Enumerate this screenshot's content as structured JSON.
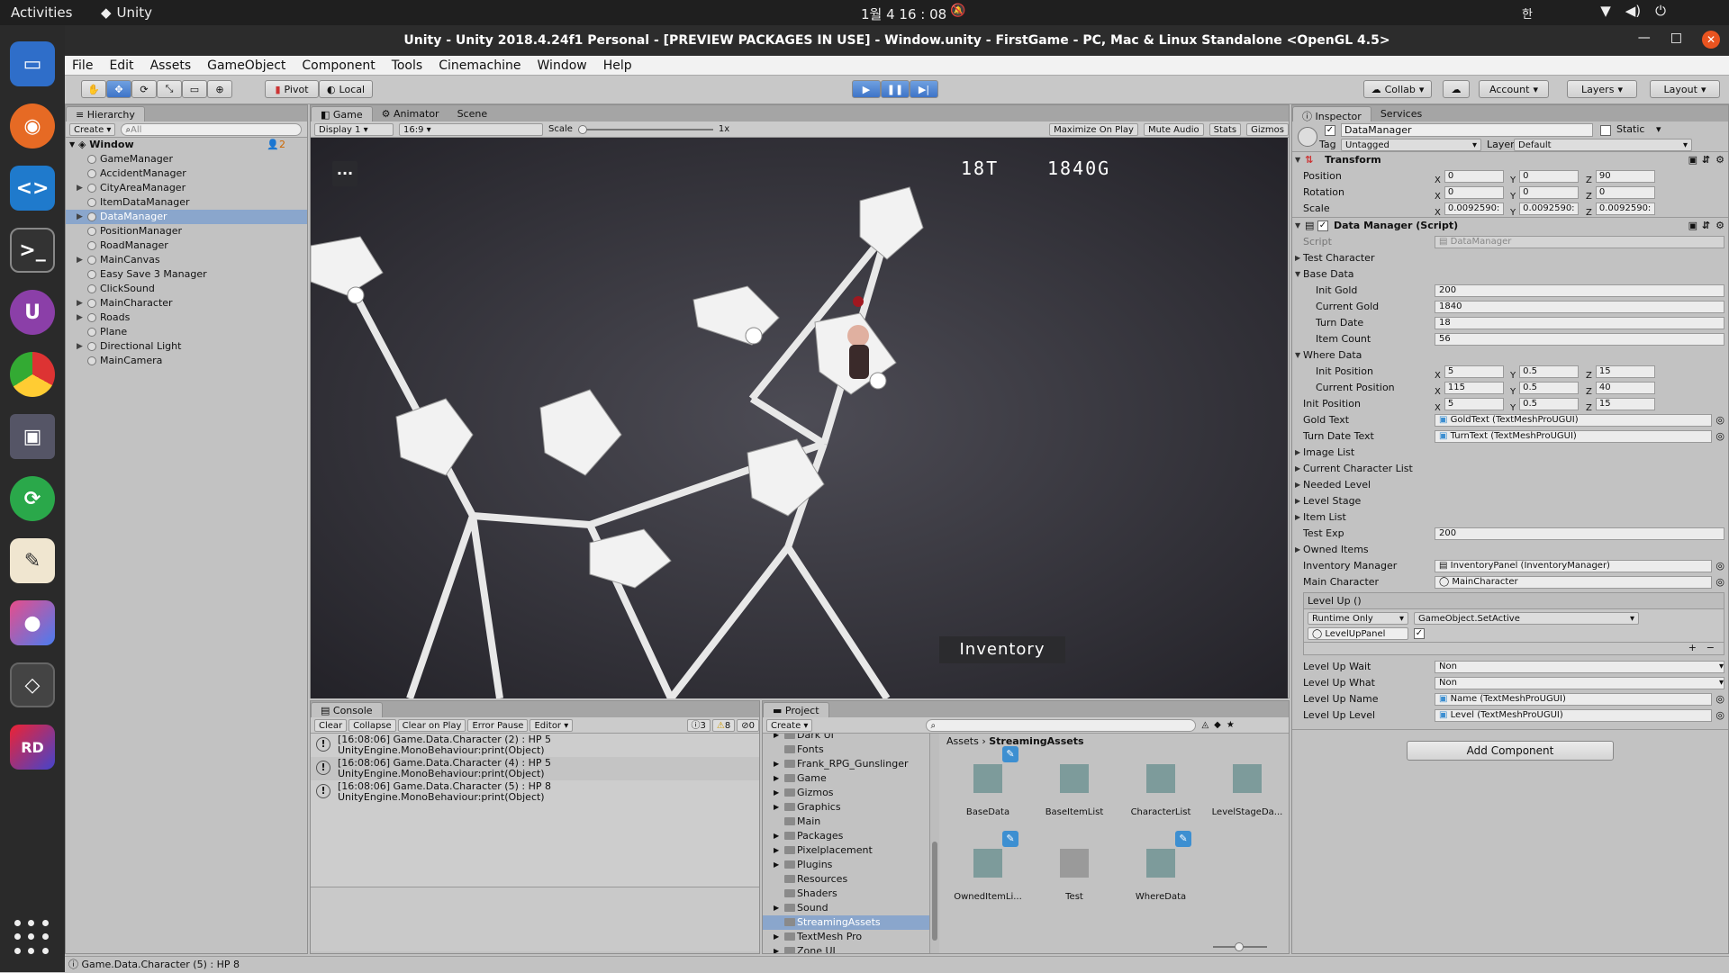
{
  "system_bar": {
    "activities": "Activities",
    "app_name": "Unity",
    "clock": "1월 4  16 : 08",
    "ime": "한"
  },
  "window": {
    "title": "Unity - Unity 2018.4.24f1 Personal - [PREVIEW PACKAGES IN USE] - Window.unity - FirstGame - PC, Mac & Linux Standalone <OpenGL 4.5>"
  },
  "menu": [
    "File",
    "Edit",
    "Assets",
    "GameObject",
    "Component",
    "Tools",
    "Cinemachine",
    "Window",
    "Help"
  ],
  "toolbar": {
    "pivot": "Pivot",
    "local": "Local",
    "collab": "Collab",
    "account": "Account",
    "layers": "Layers",
    "layout": "Layout"
  },
  "hierarchy": {
    "tab": "Hierarchy",
    "create": "Create",
    "search_placeholder": "All",
    "scene": "Window",
    "scene_count": "2",
    "items": [
      {
        "label": "GameManager",
        "expandable": false,
        "selected": false
      },
      {
        "label": "AccidentManager",
        "expandable": false,
        "selected": false
      },
      {
        "label": "CityAreaManager",
        "expandable": true,
        "selected": false
      },
      {
        "label": "ItemDataManager",
        "expandable": false,
        "selected": false
      },
      {
        "label": "DataManager",
        "expandable": true,
        "selected": true
      },
      {
        "label": "PositionManager",
        "expandable": false,
        "selected": false
      },
      {
        "label": "RoadManager",
        "expandable": false,
        "selected": false
      },
      {
        "label": "MainCanvas",
        "expandable": true,
        "selected": false
      },
      {
        "label": "Easy Save 3 Manager",
        "expandable": false,
        "selected": false
      },
      {
        "label": "ClickSound",
        "expandable": false,
        "selected": false
      },
      {
        "label": "MainCharacter",
        "expandable": true,
        "selected": false
      },
      {
        "label": "Roads",
        "expandable": true,
        "selected": false
      },
      {
        "label": "Plane",
        "expandable": false,
        "selected": false
      },
      {
        "label": "Directional Light",
        "expandable": true,
        "selected": false
      },
      {
        "label": "MainCamera",
        "expandable": false,
        "selected": false
      }
    ]
  },
  "game": {
    "tabs": [
      "Game",
      "Animator",
      "Scene"
    ],
    "display": "Display 1",
    "aspect": "16:9",
    "scale_label": "Scale",
    "scale_value": "1x",
    "options": [
      "Maximize On Play",
      "Mute Audio",
      "Stats",
      "Gizmos"
    ],
    "turn": "18T",
    "gold": "1840G",
    "menu_dots": "...",
    "inventory": "Inventory"
  },
  "console": {
    "tab": "Console",
    "buttons": [
      "Clear",
      "Collapse",
      "Clear on Play",
      "Error Pause",
      "Editor"
    ],
    "count_info": "3",
    "count_warn": "8",
    "count_err": "0",
    "entries": [
      {
        "line1": "[16:08:06] Game.Data.Character (2) : HP 5",
        "line2": "UnityEngine.MonoBehaviour:print(Object)"
      },
      {
        "line1": "[16:08:06] Game.Data.Character (4) : HP 5",
        "line2": "UnityEngine.MonoBehaviour:print(Object)"
      },
      {
        "line1": "[16:08:06] Game.Data.Character (5) : HP 8",
        "line2": "UnityEngine.MonoBehaviour:print(Object)"
      }
    ]
  },
  "project": {
    "tab": "Project",
    "create": "Create",
    "folders": [
      {
        "label": "Dark UI",
        "expandable": true,
        "selected": false
      },
      {
        "label": "Fonts",
        "expandable": false,
        "selected": false
      },
      {
        "label": "Frank_RPG_Gunslinger",
        "expandable": true,
        "selected": false
      },
      {
        "label": "Game",
        "expandable": true,
        "selected": false
      },
      {
        "label": "Gizmos",
        "expandable": true,
        "selected": false
      },
      {
        "label": "Graphics",
        "expandable": true,
        "selected": false
      },
      {
        "label": "Main",
        "expandable": false,
        "selected": false
      },
      {
        "label": "Packages",
        "expandable": true,
        "selected": false
      },
      {
        "label": "Pixelplacement",
        "expandable": true,
        "selected": false
      },
      {
        "label": "Plugins",
        "expandable": true,
        "selected": false
      },
      {
        "label": "Resources",
        "expandable": false,
        "selected": false
      },
      {
        "label": "Shaders",
        "expandable": false,
        "selected": false
      },
      {
        "label": "Sound",
        "expandable": true,
        "selected": false
      },
      {
        "label": "StreamingAssets",
        "expandable": false,
        "selected": true
      },
      {
        "label": "TextMesh Pro",
        "expandable": true,
        "selected": false
      },
      {
        "label": "Zone UI",
        "expandable": true,
        "selected": false
      }
    ],
    "breadcrumb_root": "Assets",
    "breadcrumb_current": "StreamingAssets",
    "assets": [
      {
        "label": "BaseData",
        "badge": true,
        "color": "#7d9b9b"
      },
      {
        "label": "BaseItemList",
        "badge": false,
        "color": "#7d9b9b"
      },
      {
        "label": "CharacterList",
        "badge": false,
        "color": "#7d9b9b"
      },
      {
        "label": "LevelStageDa...",
        "badge": false,
        "color": "#7d9b9b"
      },
      {
        "label": "OwnedItemLi...",
        "badge": true,
        "color": "#7d9b9b"
      },
      {
        "label": "Test",
        "badge": false,
        "color": "#9a9a9a"
      },
      {
        "label": "WhereData",
        "badge": true,
        "color": "#7d9b9b"
      }
    ]
  },
  "inspector": {
    "tabs": [
      "Inspector",
      "Services"
    ],
    "object_name": "DataManager",
    "static": "Static",
    "tag_label": "Tag",
    "tag": "Untagged",
    "layer_label": "Layer",
    "layer": "Default",
    "transform": {
      "title": "Transform",
      "position": {
        "label": "Position",
        "x": "0",
        "y": "0",
        "z": "90"
      },
      "rotation": {
        "label": "Rotation",
        "x": "0",
        "y": "0",
        "z": "0"
      },
      "scale": {
        "label": "Scale",
        "x": "0.0092590:",
        "y": "0.0092590:",
        "z": "0.0092590:"
      }
    },
    "script_title": "Data Manager (Script)",
    "script_label": "Script",
    "script_value": "DataManager",
    "test_character": "Test Character",
    "base_data": "Base Data",
    "init_gold": {
      "label": "Init Gold",
      "value": "200"
    },
    "current_gold": {
      "label": "Current Gold",
      "value": "1840"
    },
    "turn_date": {
      "label": "Turn Date",
      "value": "18"
    },
    "item_count": {
      "label": "Item Count",
      "value": "56"
    },
    "where_data": "Where Data",
    "where_init_position": {
      "label": "Init Position",
      "x": "5",
      "y": "0.5",
      "z": "15"
    },
    "where_current_position": {
      "label": "Current Position",
      "x": "115",
      "y": "0.5",
      "z": "40"
    },
    "init_position": {
      "label": "Init Position",
      "x": "5",
      "y": "0.5",
      "z": "15"
    },
    "gold_text": {
      "label": "Gold Text",
      "value": "GoldText (TextMeshProUGUI)"
    },
    "turn_date_text": {
      "label": "Turn Date Text",
      "value": "TurnText (TextMeshProUGUI)"
    },
    "image_list": "Image List",
    "current_character_list": "Current Character List",
    "needed_level": "Needed Level",
    "level_stage": "Level Stage",
    "item_list": "Item List",
    "test_exp": {
      "label": "Test Exp",
      "value": "200"
    },
    "owned_items": "Owned Items",
    "inventory_manager": {
      "label": "Inventory Manager",
      "value": "InventoryPanel (InventoryManager)"
    },
    "main_character": {
      "label": "Main Character",
      "value": "MainCharacter"
    },
    "event_title": "Level Up ()",
    "event_runtime": "Runtime Only",
    "event_function": "GameObject.SetActive",
    "event_target": "LevelUpPanel",
    "level_up_wait": {
      "label": "Level Up Wait",
      "value": "Non"
    },
    "level_up_what": {
      "label": "Level Up What",
      "value": "Non"
    },
    "level_up_name": {
      "label": "Level Up Name",
      "value": "Name (TextMeshProUGUI)"
    },
    "level_up_level": {
      "label": "Level Up Level",
      "value": "Level (TextMeshProUGUI)"
    },
    "add_component": "Add Component"
  },
  "status": "Game.Data.Character (5) : HP 8"
}
